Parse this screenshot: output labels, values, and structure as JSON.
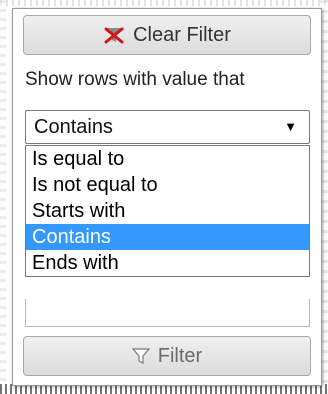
{
  "clear_filter": {
    "label": "Clear Filter",
    "icon": "funnel-x-icon",
    "icon_color": "#d7131a"
  },
  "instruction": "Show rows with value that",
  "operator": {
    "selected": "Contains",
    "options": [
      "Is equal to",
      "Is not equal to",
      "Starts with",
      "Contains",
      "Ends with"
    ],
    "highlight_color": "#3399ff"
  },
  "value_input": {
    "value": "",
    "placeholder": ""
  },
  "filter_button": {
    "label": "Filter",
    "icon": "funnel-icon"
  }
}
